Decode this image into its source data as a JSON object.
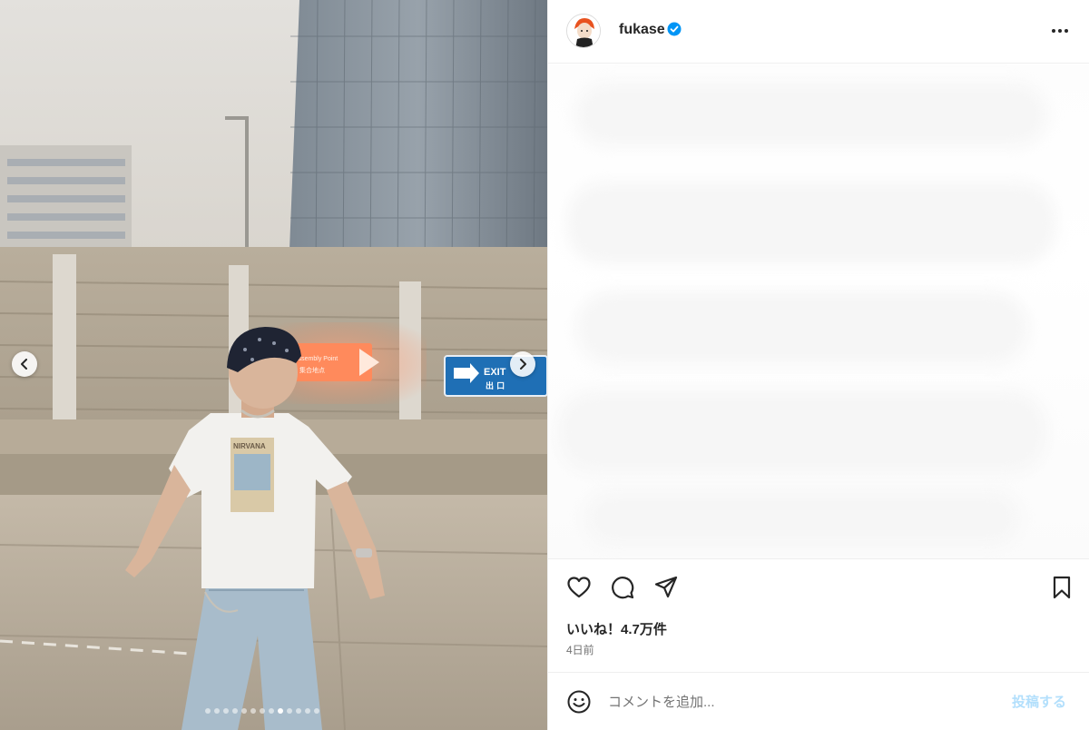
{
  "post": {
    "username": "fukase",
    "verified": true,
    "likes_text": "いいね！4.7万件",
    "timestamp": "4日前"
  },
  "carousel": {
    "slide_count": 13,
    "active_index": 8
  },
  "comment": {
    "placeholder": "コメントを追加...",
    "post_label": "投稿する"
  },
  "photo": {
    "sign_text": "Assembly Point",
    "sign_subtext": "集合地点",
    "exit_sign_text": "EXIT",
    "exit_sign_subtext": "出 口",
    "shirt_text": "NIRVANA"
  },
  "colors": {
    "accent": "#0095f6",
    "post_button": "#b2dffc",
    "text_primary": "#262626",
    "text_secondary": "#737373",
    "divider": "#efefef"
  },
  "icons": {
    "like": "heart-icon",
    "comment": "comment-bubble-icon",
    "share": "paper-plane-icon",
    "save": "bookmark-icon",
    "more": "more-options-icon",
    "emoji": "emoji-smile-icon",
    "verified": "verified-badge-icon",
    "prev": "chevron-left-icon",
    "next": "chevron-right-icon"
  }
}
